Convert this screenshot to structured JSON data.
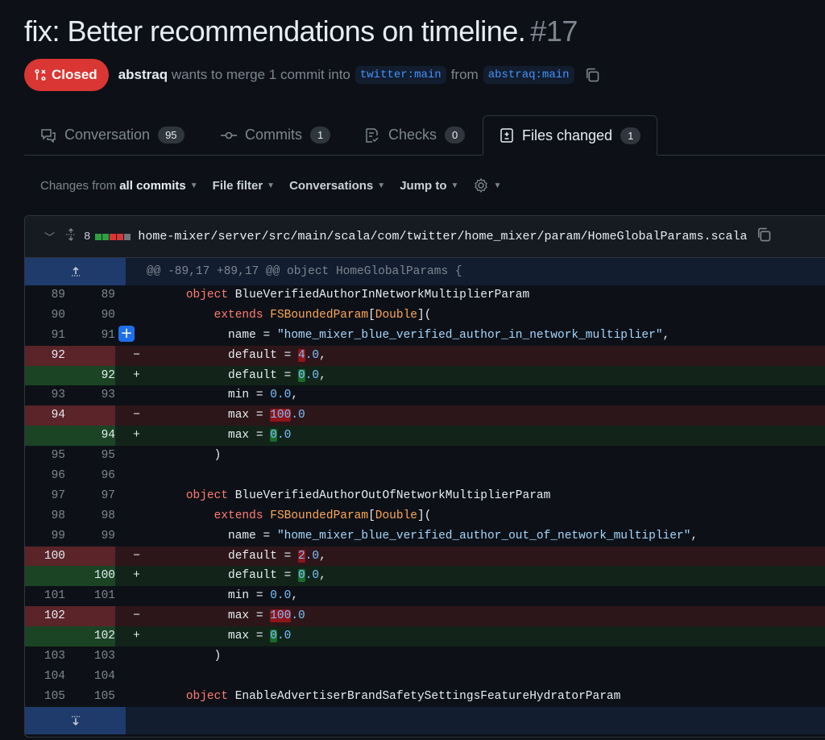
{
  "pr": {
    "title": "fix: Better recommendations on timeline.",
    "number": "#17",
    "state": "Closed",
    "author": "abstraq",
    "merge_text": "wants to merge 1 commit into",
    "base_branch": "twitter:main",
    "from_text": "from",
    "head_branch": "abstraq:main"
  },
  "tabs": [
    {
      "label": "Conversation",
      "count": "95",
      "icon": "comment-discussion-icon"
    },
    {
      "label": "Commits",
      "count": "1",
      "icon": "git-commit-icon"
    },
    {
      "label": "Checks",
      "count": "0",
      "icon": "checklist-icon"
    },
    {
      "label": "Files changed",
      "count": "1",
      "icon": "file-diff-icon",
      "active": true
    }
  ],
  "toolbar": {
    "changes_prefix": "Changes from",
    "changes_value": "all commits",
    "file_filter": "File filter",
    "conversations": "Conversations",
    "jump_to": "Jump to"
  },
  "file": {
    "changes": "8",
    "path": "home-mixer/server/src/main/scala/com/twitter/home_mixer/param/HomeGlobalParams.scala",
    "diffstat": {
      "added": 4,
      "removed": 4
    },
    "colors": {
      "added": "#2ea043",
      "removed": "#da3633",
      "neutral": "#30363d"
    }
  },
  "diff": {
    "hunk_header": "@@ -89,17 +89,17 @@ object HomeGlobalParams {"
  },
  "colors": {
    "closed": "#da3633",
    "accent": "#1f6feb",
    "bg": "#0d1117"
  }
}
